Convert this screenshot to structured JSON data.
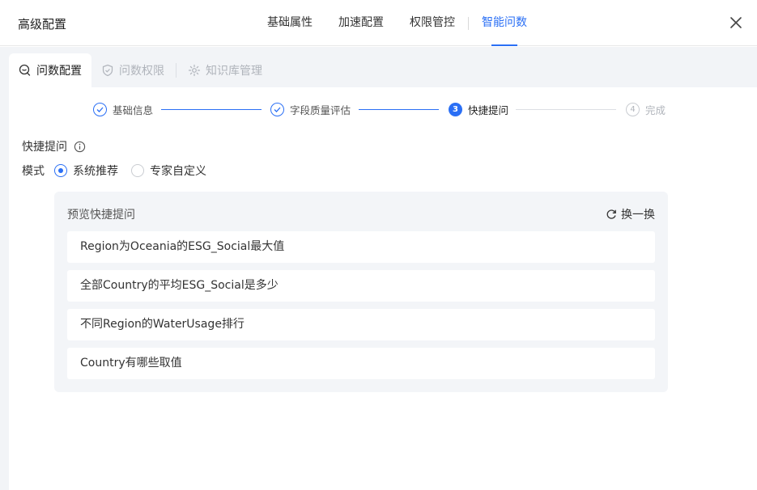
{
  "dialog": {
    "title": "高级配置",
    "tabs": [
      {
        "label": "基础属性"
      },
      {
        "label": "加速配置"
      },
      {
        "label": "权限管控"
      },
      {
        "label": "智能问数",
        "active": true
      }
    ],
    "close_icon": "close-icon"
  },
  "sub_tabs": [
    {
      "label": "问数配置",
      "icon": "chat-bubble-icon",
      "active": true
    },
    {
      "label": "问数权限",
      "icon": "shield-check-icon"
    },
    {
      "label": "知识库管理",
      "icon": "gear-icon"
    }
  ],
  "steps": [
    {
      "label": "基础信息",
      "status": "done"
    },
    {
      "label": "字段质量评估",
      "status": "done"
    },
    {
      "label": "快捷提问",
      "status": "active",
      "number": "3"
    },
    {
      "label": "完成",
      "status": "todo",
      "number": "4"
    }
  ],
  "form": {
    "quick_question_label": "快捷提问",
    "mode_label": "模式",
    "mode_options": [
      {
        "label": "系统推荐",
        "checked": true
      },
      {
        "label": "专家自定义",
        "checked": false
      }
    ]
  },
  "preview": {
    "title": "预览快捷提问",
    "refresh_label": "换一换",
    "questions": [
      "Region为Oceania的ESG_Social最大值",
      "全部Country的平均ESG_Social是多少",
      "不同Region的WaterUsage排行",
      "Country有哪些取值"
    ]
  },
  "colors": {
    "accent": "#2a6ff5",
    "muted": "#b0b4bb",
    "preview_bg": "#f3f5f8"
  }
}
